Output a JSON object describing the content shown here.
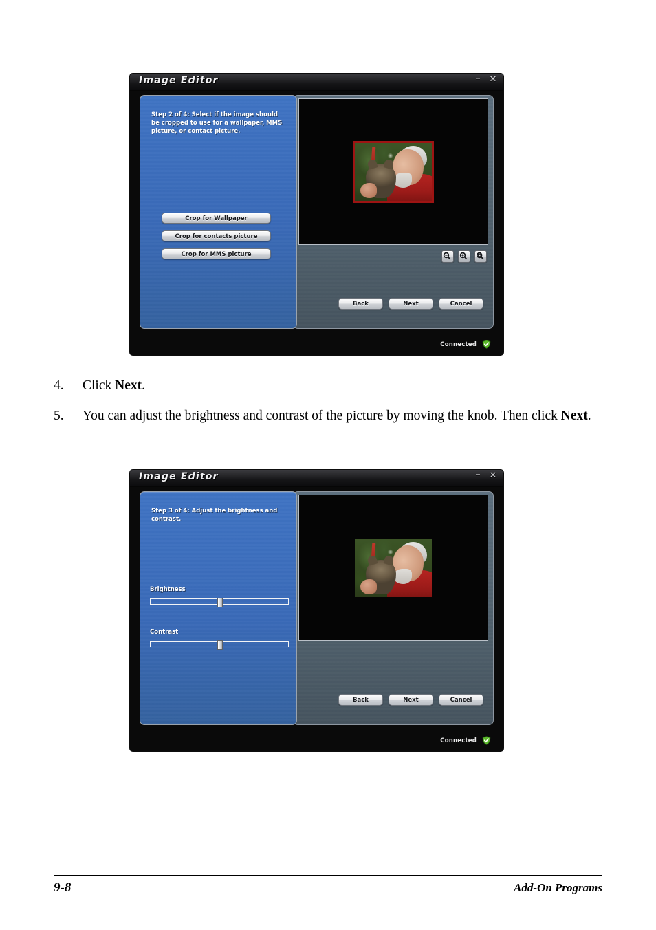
{
  "document": {
    "steps": [
      {
        "number": "4.",
        "text_before": "Click ",
        "bold": "Next",
        "text_after": "."
      },
      {
        "number": "5.",
        "text_before": "You can adjust the brightness and contrast of the picture by moving the knob. Then click ",
        "bold": "Next",
        "text_after": "."
      }
    ],
    "footer": {
      "page_number": "9-8",
      "section": "Add-On Programs"
    }
  },
  "screenshots": [
    {
      "window_title": "Image Editor",
      "minimize_label": "–",
      "close_label": "✕",
      "step_text": "Step 2 of 4: Select if the image should be cropped to use for a wallpaper, MMS picture, or contact picture.",
      "crop_buttons": [
        "Crop for Wallpaper",
        "Crop for contacts picture",
        "Crop for MMS picture"
      ],
      "zoom_buttons": [
        "zoom-out-icon",
        "zoom-in-icon",
        "zoom-fit-icon"
      ],
      "nav_buttons": [
        "Back",
        "Next",
        "Cancel"
      ],
      "status": "Connected",
      "status_icon": "green-check-shield-icon",
      "preview_has_crop_frame": true,
      "crop_frame_color": "#9e1413"
    },
    {
      "window_title": "Image Editor",
      "minimize_label": "–",
      "close_label": "✕",
      "step_text": "Step 3 of 4: Adjust the brightness and contrast.",
      "sliders": [
        {
          "label": "Brightness",
          "value_percent": 50
        },
        {
          "label": "Contrast",
          "value_percent": 50
        }
      ],
      "nav_buttons": [
        "Back",
        "Next",
        "Cancel"
      ],
      "status": "Connected",
      "status_icon": "green-check-shield-icon",
      "preview_has_crop_frame": false
    }
  ],
  "colors": {
    "wizard_blue": "#3a6dbd",
    "panel_gray": "#4e606e",
    "window_black": "#0a0a0a",
    "status_green": "#5cb82b",
    "crop_red": "#9e1413"
  }
}
